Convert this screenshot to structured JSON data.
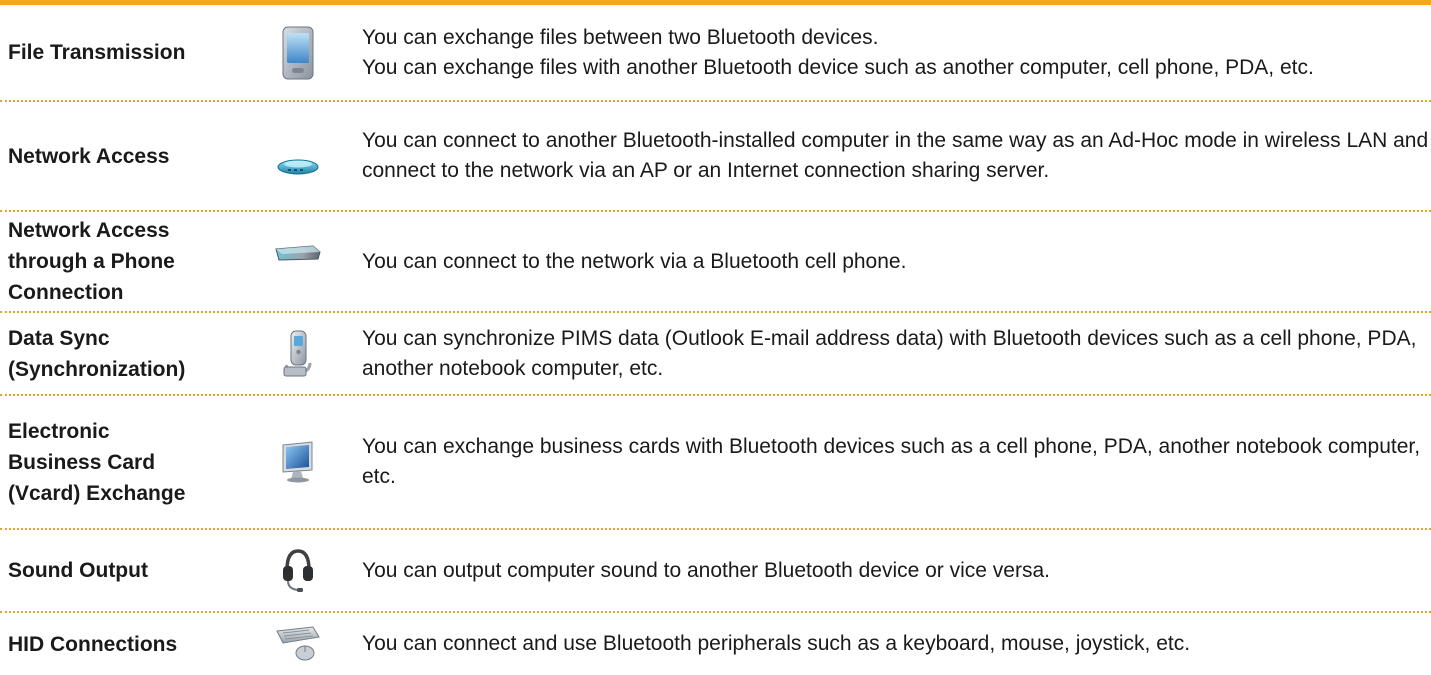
{
  "accent_color": "#f2a81d",
  "divider_color": "#e3a628",
  "rows": [
    {
      "label": "File Transmission",
      "icon": "pda-icon",
      "description": "You can exchange files between two Bluetooth devices.\nYou can exchange files with another Bluetooth device such as another computer, cell phone, PDA, etc."
    },
    {
      "label": "Network Access",
      "icon": "access-point-icon",
      "description": "You can connect to another Bluetooth-installed computer in the same way as an Ad-Hoc mode in wireless LAN and connect to the network via an AP or an Internet connection sharing server."
    },
    {
      "label": "Network Access\nthrough a Phone\nConnection",
      "icon": "modem-icon",
      "description": "You can connect to the network via a Bluetooth cell phone."
    },
    {
      "label": "Data Sync\n(Synchronization)",
      "icon": "phone-sync-icon",
      "description": "You can synchronize PIMS data (Outlook E-mail address data) with Bluetooth devices such as a cell phone, PDA, another notebook computer, etc."
    },
    {
      "label": "Electronic\nBusiness Card\n(Vcard) Exchange",
      "icon": "monitor-icon",
      "description": "You can exchange business cards with Bluetooth devices such as a cell phone, PDA, another notebook computer, etc."
    },
    {
      "label": "Sound Output",
      "icon": "headset-icon",
      "description": "You can output computer sound to another Bluetooth device or vice versa."
    },
    {
      "label": "HID Connections",
      "icon": "keyboard-mouse-icon",
      "description": "You can connect and use Bluetooth peripherals such as a keyboard, mouse, joystick, etc."
    }
  ]
}
